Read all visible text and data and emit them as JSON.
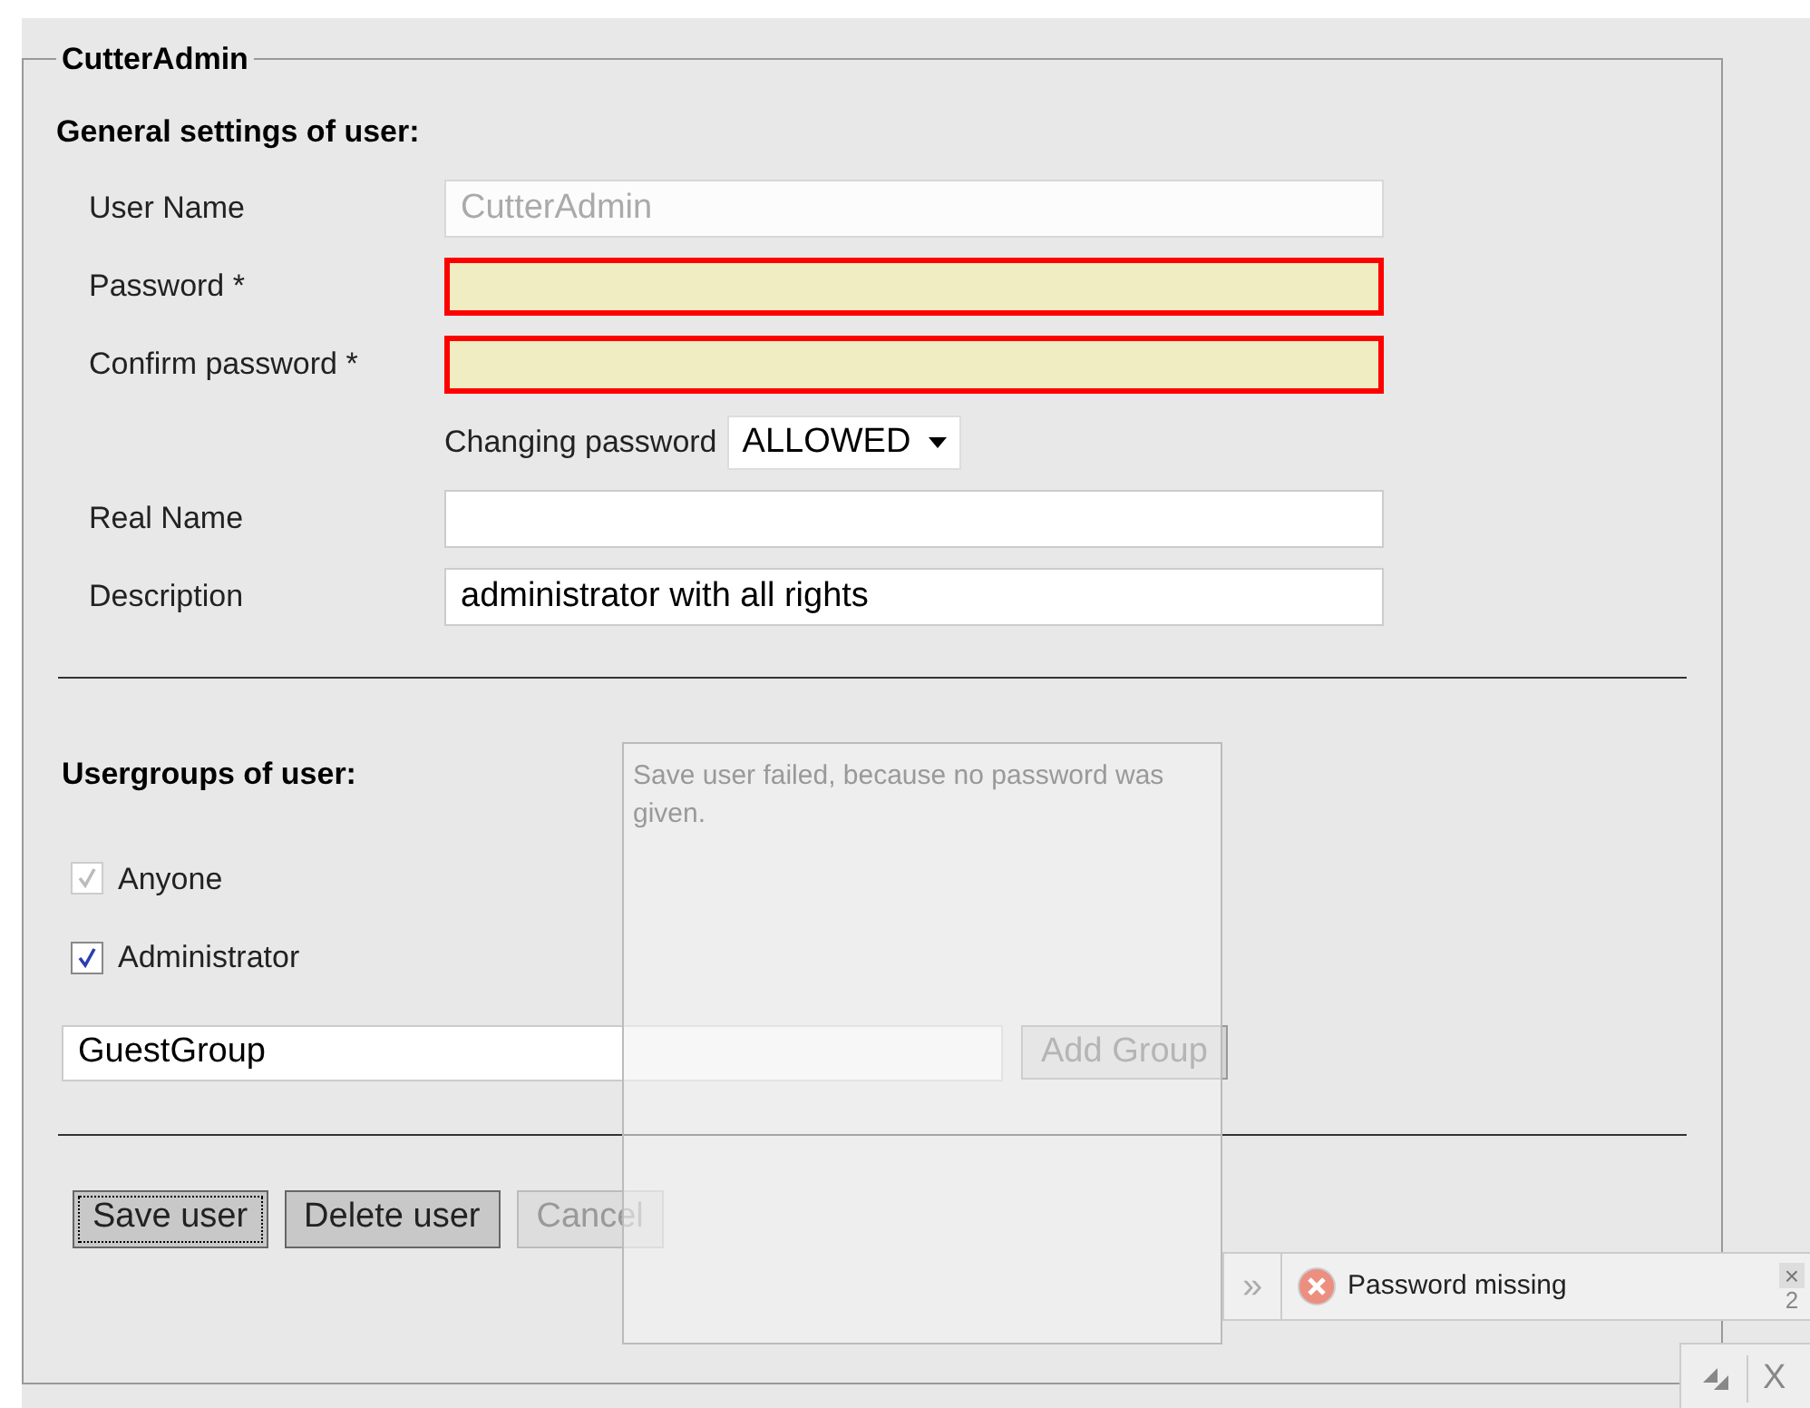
{
  "fieldset": {
    "legend": "CutterAdmin"
  },
  "general": {
    "heading": "General settings of user:",
    "fields": [
      {
        "kind": "text",
        "label": "User Name",
        "value": "CutterAdmin",
        "disabled": true,
        "invalid": false
      },
      {
        "kind": "text",
        "label": "Password *",
        "disabled": false,
        "invalid": true
      },
      {
        "kind": "text",
        "label": "Confirm password *",
        "disabled": false,
        "invalid": true
      },
      {
        "kind": "select",
        "label": "Changing password",
        "value": "ALLOWED"
      },
      {
        "kind": "text",
        "label": "Real Name",
        "disabled": false,
        "invalid": false
      },
      {
        "kind": "text",
        "label": "Description",
        "value": "administrator with all rights",
        "disabled": false,
        "invalid": false
      }
    ]
  },
  "usergroups": {
    "heading": "Usergroups of user:",
    "groups": [
      {
        "label": "Anyone",
        "checked": true,
        "disabled": true
      },
      {
        "label": "Administrator",
        "checked": true,
        "disabled": false
      }
    ],
    "new_group": {
      "value": "GuestGroup"
    },
    "add_button": {
      "label": "Add Group",
      "disabled": true
    }
  },
  "buttons": [
    {
      "label": "Save user",
      "focused": true,
      "disabled": false
    },
    {
      "label": "Delete user",
      "focused": false,
      "disabled": false
    },
    {
      "label": "Cancel",
      "focused": false,
      "disabled": true
    }
  ],
  "tooltip": {
    "text": "Save user failed, because no password was given."
  },
  "notification": {
    "arrow": "»",
    "message": "Password missing",
    "close": "×",
    "count": "2"
  },
  "corner": {
    "close": "X"
  }
}
